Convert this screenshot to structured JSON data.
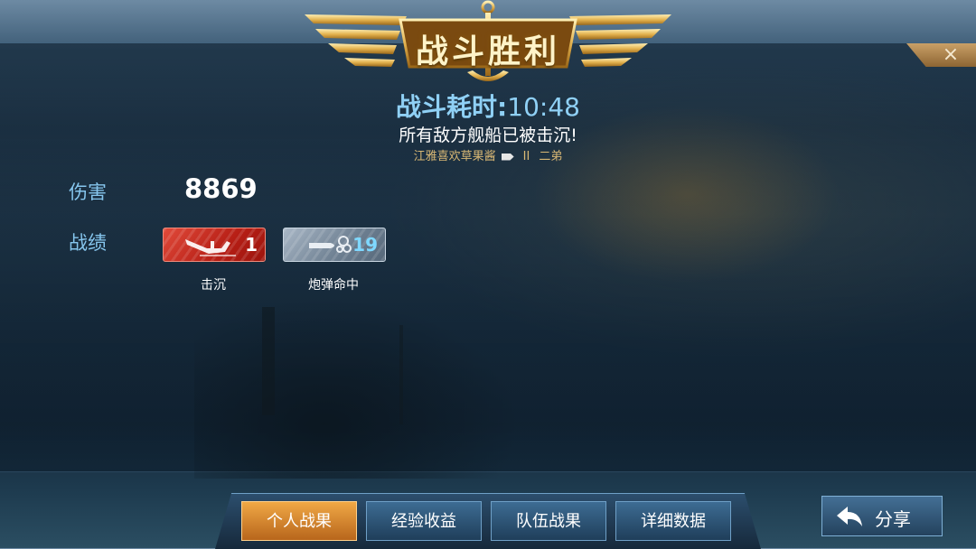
{
  "header": {
    "title": "战斗胜利",
    "close_icon": "×"
  },
  "summary": {
    "time_label": "战斗耗时: ",
    "time_value": "10:48",
    "message": "所有敌方舰船已被击沉!",
    "player_name": "江雅喜欢草果酱",
    "divider": "II",
    "rank_text": "二弟"
  },
  "stats": {
    "damage_label": "伤害",
    "damage_value": "8869",
    "record_label": "战绩",
    "medals": [
      {
        "count": "1",
        "caption": "击沉",
        "color": "#c8261c",
        "icon": "ship-sinking-icon"
      },
      {
        "count": "19",
        "caption": "炮弹命中",
        "color": "#6d7f91",
        "icon": "shell-icon"
      }
    ]
  },
  "tabs": [
    {
      "label": "个人战果",
      "active": true
    },
    {
      "label": "经验收益",
      "active": false
    },
    {
      "label": "队伍战果",
      "active": false
    },
    {
      "label": "详细数据",
      "active": false
    }
  ],
  "share": {
    "label": "分享",
    "icon": "share-arrow-icon"
  },
  "colors": {
    "accent_blue": "#86c6ee",
    "gold": "#d8b774",
    "active_tab": "#e08a2e"
  }
}
